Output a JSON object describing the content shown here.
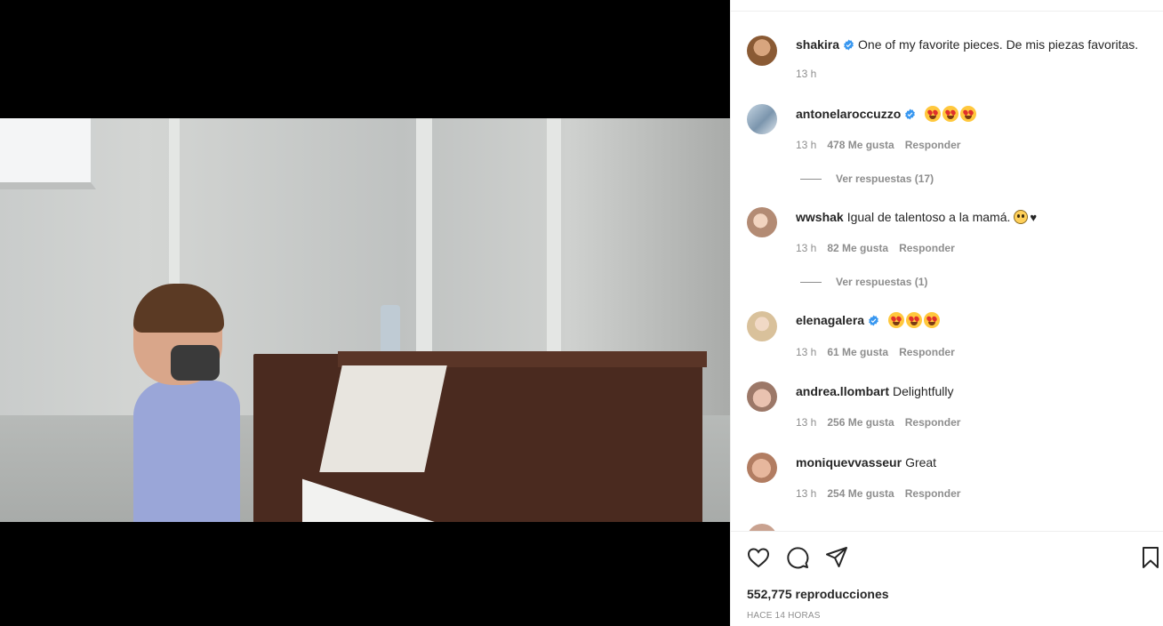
{
  "post": {
    "author": "shakira",
    "caption": "One of my favorite pieces. De mis piezas favoritas.",
    "caption_time": "13 h"
  },
  "comments": [
    {
      "user": "antonelaroccuzzo",
      "verified": true,
      "text": "",
      "emojis": [
        "heart-eyes-emoji",
        "heart-eyes-emoji",
        "heart-eyes-emoji"
      ],
      "time": "13 h",
      "likes": "478 Me gusta",
      "reply": "Responder",
      "view_replies": "Ver respuestas (17)"
    },
    {
      "user": "wwshak",
      "verified": false,
      "text": "Igual de talentoso a la mamá.",
      "emojis": [
        "sad-face-emoji",
        "black-heart-emoji"
      ],
      "time": "13 h",
      "likes": "82 Me gusta",
      "reply": "Responder",
      "view_replies": "Ver respuestas (1)"
    },
    {
      "user": "elenagalera",
      "verified": true,
      "text": "",
      "emojis": [
        "heart-eyes-emoji",
        "heart-eyes-emoji",
        "heart-eyes-emoji"
      ],
      "time": "13 h",
      "likes": "61 Me gusta",
      "reply": "Responder"
    },
    {
      "user": "andrea.llombart",
      "verified": false,
      "text": "Delightfully",
      "time": "13 h",
      "likes": "256 Me gusta",
      "reply": "Responder"
    },
    {
      "user": "moniquevvasseur",
      "verified": false,
      "text": "Great",
      "time": "13 h",
      "likes": "254 Me gusta",
      "reply": "Responder"
    }
  ],
  "stats": {
    "views_count": "552,775",
    "views_label": "reproducciones",
    "posted_ago": "HACE 14 HORAS"
  },
  "icons": {
    "like": "heart-outline-icon",
    "comment": "comment-bubble-icon",
    "share": "paper-plane-icon",
    "save": "bookmark-icon",
    "verified": "verified-badge-icon"
  },
  "colors": {
    "verified": "#3897f0",
    "text": "#262626",
    "muted": "#8e8e8e",
    "video_bg": "#000000"
  }
}
